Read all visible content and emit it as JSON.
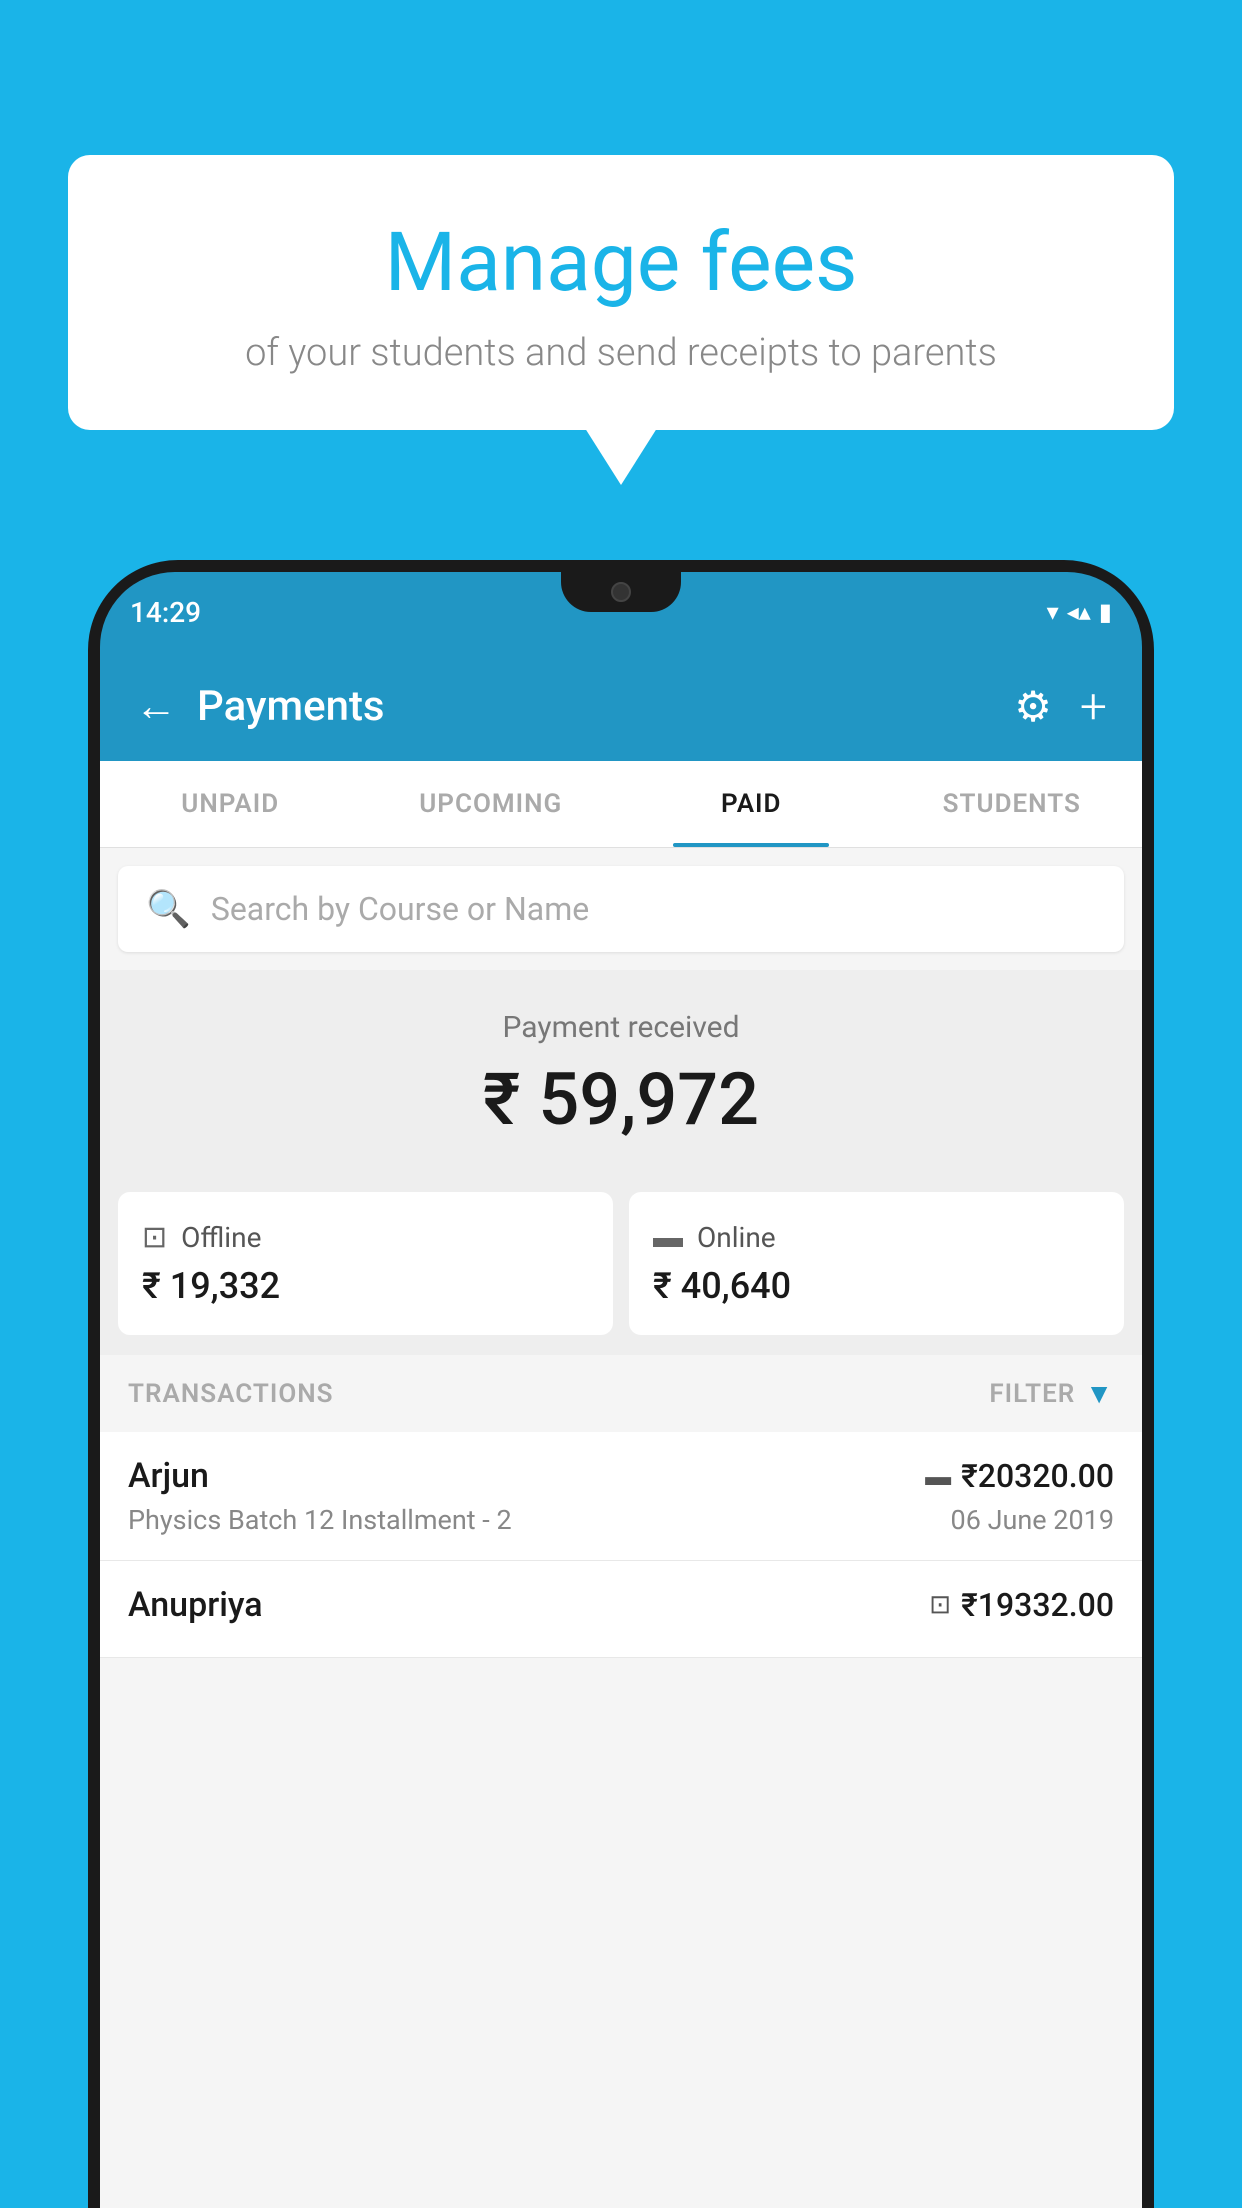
{
  "background_color": "#1ab4e8",
  "speech_bubble": {
    "title": "Manage fees",
    "subtitle": "of your students and send receipts to parents"
  },
  "status_bar": {
    "time": "14:29",
    "wifi": "▼",
    "signal": "▲",
    "battery": "▮"
  },
  "header": {
    "title": "Payments",
    "back_label": "←",
    "gear_label": "⚙",
    "plus_label": "+"
  },
  "tabs": [
    {
      "id": "unpaid",
      "label": "UNPAID",
      "active": false
    },
    {
      "id": "upcoming",
      "label": "UPCOMING",
      "active": false
    },
    {
      "id": "paid",
      "label": "PAID",
      "active": true
    },
    {
      "id": "students",
      "label": "STUDENTS",
      "active": false
    }
  ],
  "search": {
    "placeholder": "Search by Course or Name"
  },
  "payment_summary": {
    "label": "Payment received",
    "amount": "₹ 59,972",
    "offline_label": "Offline",
    "offline_amount": "₹ 19,332",
    "online_label": "Online",
    "online_amount": "₹ 40,640"
  },
  "transactions_section": {
    "label": "TRANSACTIONS",
    "filter_label": "FILTER"
  },
  "transactions": [
    {
      "name": "Arjun",
      "course": "Physics Batch 12 Installment - 2",
      "amount": "₹20320.00",
      "date": "06 June 2019",
      "payment_type": "card"
    },
    {
      "name": "Anupriya",
      "course": "",
      "amount": "₹19332.00",
      "date": "",
      "payment_type": "cash"
    }
  ]
}
